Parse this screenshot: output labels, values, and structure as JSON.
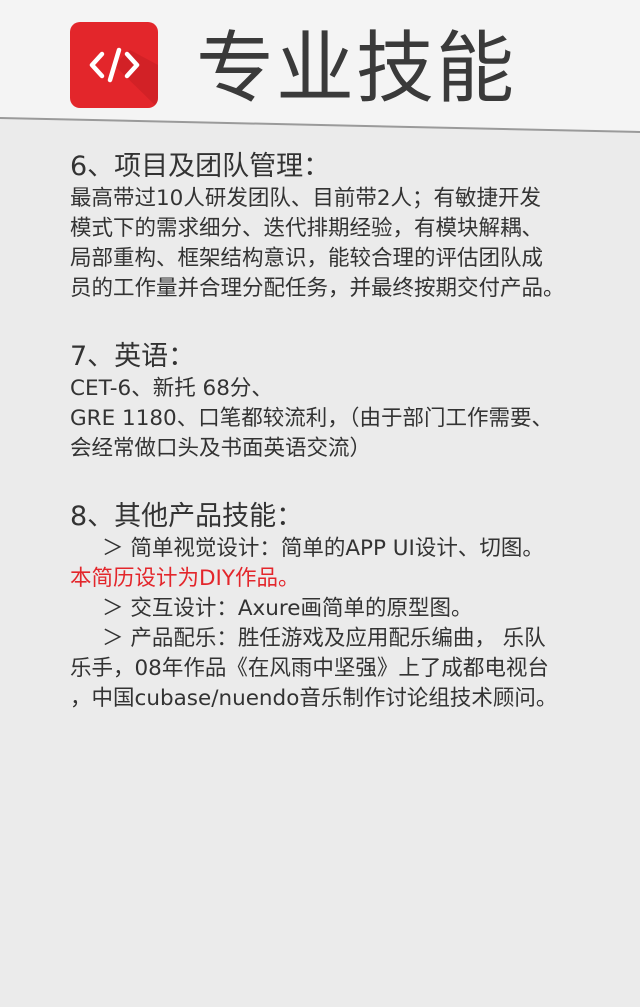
{
  "header": {
    "logo_icon": "code-tag-icon",
    "logo_color": "#e3262b",
    "title": "专业技能"
  },
  "sections": [
    {
      "title": "6、项目及团队管理：",
      "lines": [
        "最高带过10人研发团队、目前带2人；有敏捷开发",
        "模式下的需求细分、迭代排期经验，有模块解耦、",
        "局部重构、框架结构意识，能较合理的评估团队成",
        "员的工作量并合理分配任务，并最终按期交付产品。"
      ]
    },
    {
      "title": "7、英语：",
      "lines": [
        "CET-6、新托 68分、",
        "GRE 1180、口笔都较流利，（由于部门工作需要、",
        "会经常做口头及书面英语交流）"
      ]
    },
    {
      "title": "8、其他产品技能：",
      "lines": [
        "＞ 简单视觉设计：简单的APP UI设计、切图。",
        "本简历设计为DIY作品。",
        "＞ 交互设计：Axure画简单的原型图。",
        "＞ 产品配乐：胜任游戏及应用配乐编曲， 乐队",
        "乐手，08年作品《在风雨中坚强》上了成都电视台",
        "，中国cubase/nuendo音乐制作讨论组技术顾问。"
      ]
    }
  ],
  "colors": {
    "background": "#ebebeb",
    "header_background": "#f4f4f4",
    "accent": "#e3262b",
    "text": "#333333"
  }
}
